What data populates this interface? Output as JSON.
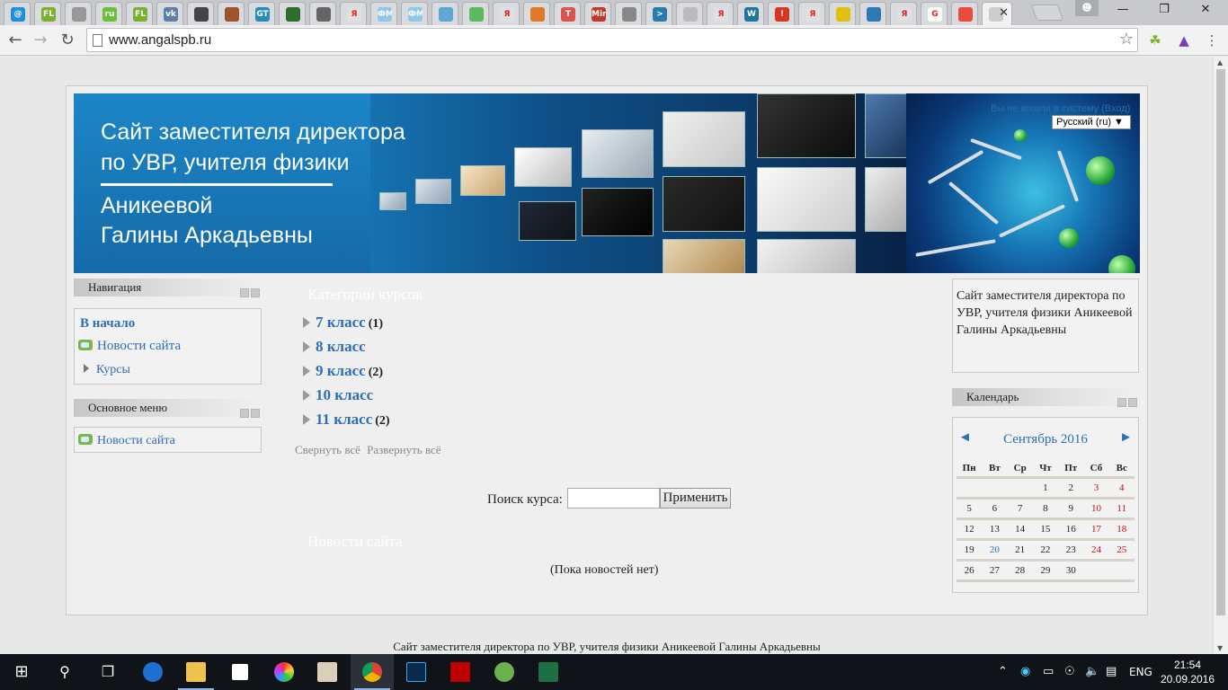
{
  "browser": {
    "url": "www.angalspb.ru",
    "tabs": [
      {
        "icon": "at-icon",
        "color": "#1f8fd6",
        "glyph": "@"
      },
      {
        "icon": "fl-icon",
        "color": "#7ab030",
        "glyph": "FL"
      },
      {
        "icon": "rss-icon",
        "color": "#999999",
        "glyph": ""
      },
      {
        "icon": "ru-icon",
        "color": "#6abf3b",
        "glyph": "ru"
      },
      {
        "icon": "fl-icon",
        "color": "#7ab030",
        "glyph": "FL"
      },
      {
        "icon": "vk-icon",
        "color": "#5b7fa6",
        "glyph": "vk"
      },
      {
        "icon": "site-icon",
        "color": "#444444",
        "glyph": ""
      },
      {
        "icon": "blocks-icon",
        "color": "#a0522d",
        "glyph": ""
      },
      {
        "icon": "gt-icon",
        "color": "#2a8cb6",
        "glyph": "GT"
      },
      {
        "icon": "green-square-icon",
        "color": "#2f6b2f",
        "glyph": ""
      },
      {
        "icon": "spider-icon",
        "color": "#666666",
        "glyph": ""
      },
      {
        "icon": "yandex-icon",
        "color": "#e0e0e0",
        "glyph": "Я"
      },
      {
        "icon": "fm-icon",
        "color": "#8fc7e8",
        "glyph": "ФМ"
      },
      {
        "icon": "fm-icon",
        "color": "#8fc7e8",
        "glyph": "ФМ"
      },
      {
        "icon": "globe-icon",
        "color": "#5da9d6",
        "glyph": ""
      },
      {
        "icon": "camera-icon",
        "color": "#5cb85c",
        "glyph": ""
      },
      {
        "icon": "yandex-icon",
        "color": "#e0e0e0",
        "glyph": "Я"
      },
      {
        "icon": "ball-icon",
        "color": "#e07a2b",
        "glyph": ""
      },
      {
        "icon": "t-icon",
        "color": "#d9534f",
        "glyph": "T"
      },
      {
        "icon": "minisoft-icon",
        "color": "#c0392b",
        "glyph": "Mini"
      },
      {
        "icon": "person-icon",
        "color": "#888888",
        "glyph": ""
      },
      {
        "icon": "arrow-icon",
        "color": "#2a7ab0",
        "glyph": ">"
      },
      {
        "icon": "page-icon",
        "color": "#bbbbbb",
        "glyph": ""
      },
      {
        "icon": "yandex-icon",
        "color": "#e0e0e0",
        "glyph": "Я"
      },
      {
        "icon": "wordpress-icon",
        "color": "#21759b",
        "glyph": "W"
      },
      {
        "icon": "alert-icon",
        "color": "#d9361e",
        "glyph": "!"
      },
      {
        "icon": "yandex-icon",
        "color": "#e0e0e0",
        "glyph": "Я"
      },
      {
        "icon": "note-icon",
        "color": "#e2c010",
        "glyph": ""
      },
      {
        "icon": "login-icon",
        "color": "#2c7bb6",
        "glyph": ""
      },
      {
        "icon": "yandex-icon",
        "color": "#e0e0e0",
        "glyph": "Я"
      },
      {
        "icon": "google-icon",
        "color": "#ffffff",
        "glyph": "G"
      },
      {
        "icon": "stats-icon",
        "color": "#e74c3c",
        "glyph": ""
      },
      {
        "icon": "loading-icon",
        "color": "#cccccc",
        "glyph": ""
      }
    ]
  },
  "header": {
    "title_line1": "Сайт заместителя директора",
    "title_line2": "по УВР, учителя физики",
    "title_line3": "Аникеевой",
    "title_line4": "Галины Аркадьевны",
    "login_text": "Вы не вошли в систему (Вход)",
    "language": "Русский (ru) ▼"
  },
  "left": {
    "nav_title": "Навигация",
    "nav_home": "В начало",
    "nav_news": "Новости сайта",
    "nav_courses": "Курсы",
    "menu_title": "Основное меню",
    "menu_news": "Новости сайта"
  },
  "main": {
    "categories_title": "Категории курсов",
    "categories": [
      {
        "name": "7 класс",
        "count": "(1)"
      },
      {
        "name": "8 класс",
        "count": ""
      },
      {
        "name": "9 класс",
        "count": "(2)"
      },
      {
        "name": "10 класс",
        "count": ""
      },
      {
        "name": "11 класс",
        "count": "(2)"
      }
    ],
    "collapse_all": "Свернуть всё",
    "expand_all": "Развернуть всё",
    "search_label": "Поиск курса:",
    "search_value": "",
    "search_button": "Применить",
    "news_title": "Новости сайта",
    "news_empty": "(Пока новостей нет)"
  },
  "right": {
    "about": "Сайт заместителя директора по УВР, учителя физики Аникеевой Галины Аркадьевны",
    "calendar_title": "Календарь",
    "prev": "◄",
    "next": "►",
    "month": "Сентябрь 2016",
    "weekdays": [
      "Пн",
      "Вт",
      "Ср",
      "Чт",
      "Пт",
      "Сб",
      "Вс"
    ],
    "weeks": [
      [
        "",
        "",
        "",
        "1",
        "2",
        "3",
        "4"
      ],
      [
        "5",
        "6",
        "7",
        "8",
        "9",
        "10",
        "11"
      ],
      [
        "12",
        "13",
        "14",
        "15",
        "16",
        "17",
        "18"
      ],
      [
        "19",
        "20",
        "21",
        "22",
        "23",
        "24",
        "25"
      ],
      [
        "26",
        "27",
        "28",
        "29",
        "30",
        "",
        ""
      ]
    ],
    "today": "20"
  },
  "footer": "Сайт заместителя директора по УВР, учителя физики Аникеевой Галины Аркадьевны",
  "taskbar": {
    "language": "ENG",
    "time": "21:54",
    "date": "20.09.2016"
  }
}
